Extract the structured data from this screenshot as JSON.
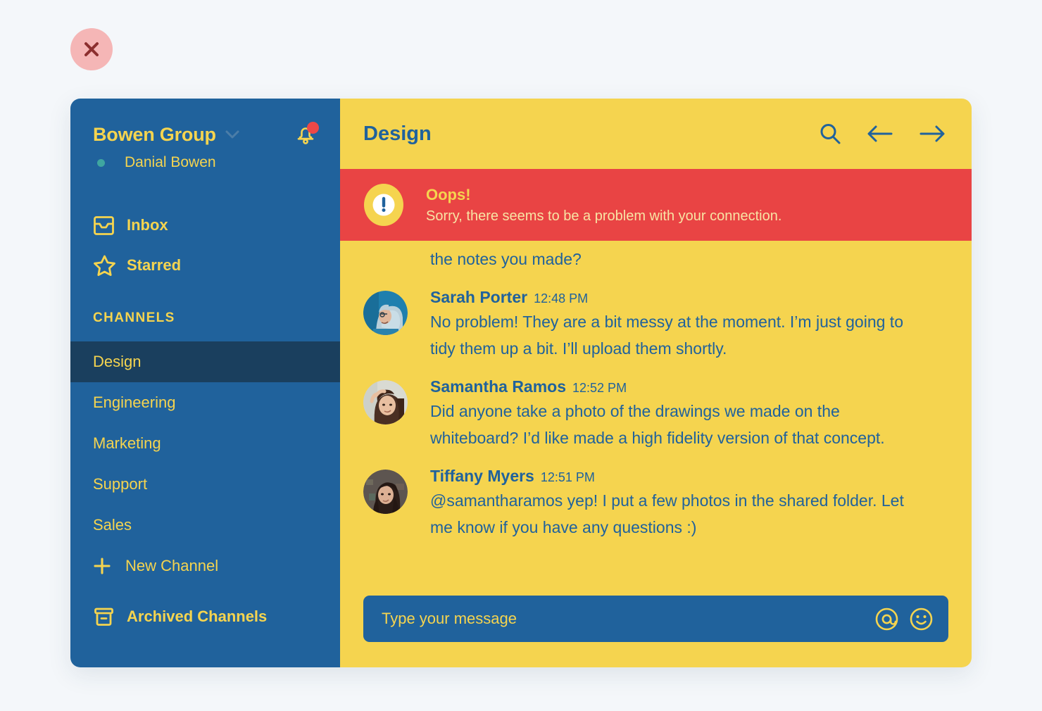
{
  "close_button": {
    "icon": "close-icon",
    "color": "#8c2f2f",
    "bg": "#f5b6b6"
  },
  "colors": {
    "page_bg": "#f4f7fa",
    "sidebar_blue": "#20629C",
    "accent_yellow": "#F5D44F",
    "active_channel": "#1A3F5E",
    "error_red": "#E94444",
    "presence_green": "#3FA6A0",
    "badge_red": "#ED4848"
  },
  "sidebar": {
    "workspace": {
      "name": "Bowen Group",
      "chevron_icon": "chevron-down-icon"
    },
    "notifications": {
      "icon": "bell-icon",
      "has_badge": true
    },
    "user": {
      "name": "Danial Bowen",
      "status": "online"
    },
    "nav": [
      {
        "key": "inbox",
        "label": "Inbox",
        "icon": "inbox-icon"
      },
      {
        "key": "starred",
        "label": "Starred",
        "icon": "star-icon"
      }
    ],
    "section_title": "CHANNELS",
    "channels": [
      {
        "label": "Design",
        "active": true
      },
      {
        "label": "Engineering",
        "active": false
      },
      {
        "label": "Marketing",
        "active": false
      },
      {
        "label": "Support",
        "active": false
      },
      {
        "label": "Sales",
        "active": false
      }
    ],
    "new_channel": {
      "label": "New Channel",
      "icon": "plus-icon"
    },
    "archived": {
      "label": "Archived Channels",
      "icon": "archive-box-icon"
    }
  },
  "header": {
    "title": "Design",
    "actions": [
      {
        "key": "search",
        "icon": "search-icon"
      },
      {
        "key": "back",
        "icon": "arrow-left-icon"
      },
      {
        "key": "forward",
        "icon": "arrow-right-icon"
      }
    ]
  },
  "error_banner": {
    "icon": "alert-exclamation-icon",
    "title": "Oops!",
    "message": "Sorry, there seems to be a problem with your connection."
  },
  "messages": {
    "partial_top_line": "the notes you made?",
    "items": [
      {
        "author": "Sarah Porter",
        "time": "12:48 PM",
        "text": "No problem! They are a bit messy at the moment. I’m just going to tidy them up a bit. I’ll upload them shortly.",
        "avatar": "avatar-sarah-porter"
      },
      {
        "author": "Samantha Ramos",
        "time": "12:52 PM",
        "text": "Did anyone take a photo of the drawings we made on the whiteboard? I’d like made a high fidelity version of that concept.",
        "avatar": "avatar-samantha-ramos"
      },
      {
        "author": "Tiffany Myers",
        "time": "12:51 PM",
        "text": "@samantharamos yep! I put a few photos in the shared folder. Let me know if you have any questions :)",
        "avatar": "avatar-tiffany-myers"
      }
    ]
  },
  "composer": {
    "placeholder": "Type your message",
    "value": "",
    "actions": [
      {
        "key": "mention",
        "icon": "at-mention-icon"
      },
      {
        "key": "emoji",
        "icon": "smiley-face-icon"
      }
    ]
  }
}
